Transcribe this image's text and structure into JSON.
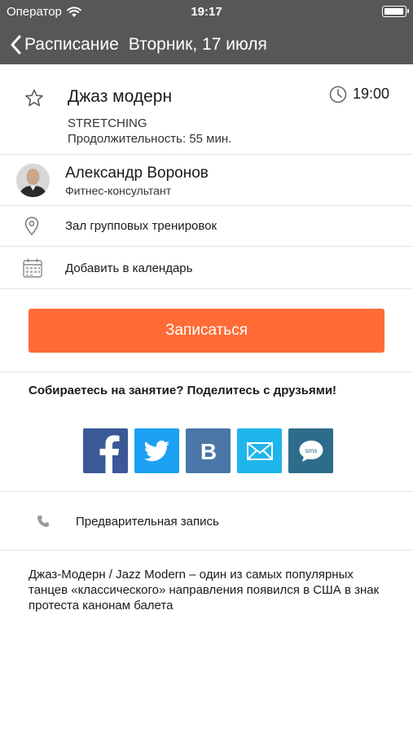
{
  "status_bar": {
    "carrier": "Оператор",
    "time": "19:17",
    "battery_level": 0.95
  },
  "nav": {
    "back_label": "Расписание",
    "title": "Вторник, 17 июля"
  },
  "class_info": {
    "title": "Джаз модерн",
    "type": "STRETCHING",
    "duration": "Продолжительность: 55 мин.",
    "time": "19:00",
    "favorite_icon": "star-outline-icon"
  },
  "trainer": {
    "name": "Александр Воронов",
    "role": "Фитнес-консультант"
  },
  "location": {
    "label": "Зал групповых тренировок",
    "icon": "location-pin-icon"
  },
  "calendar": {
    "label": "Добавить в календарь",
    "icon": "calendar-icon"
  },
  "signup": {
    "label": "Записаться",
    "color": "#ff6b35"
  },
  "share": {
    "title": "Собираетесь на занятие? Поделитесь с друзьями!",
    "buttons": [
      {
        "name": "facebook",
        "icon": "facebook-icon",
        "color": "#3b5998"
      },
      {
        "name": "twitter",
        "icon": "twitter-icon",
        "color": "#1da1f2"
      },
      {
        "name": "vkontakte",
        "icon": "vk-icon",
        "color": "#4a76a8"
      },
      {
        "name": "email",
        "icon": "mail-icon",
        "color": "#1eb6ea"
      },
      {
        "name": "sms",
        "icon": "sms-icon",
        "color": "#2e6c8c"
      }
    ]
  },
  "booking": {
    "label": "Предварительная запись",
    "icon": "phone-icon"
  },
  "description": {
    "text": "Джаз-Модерн / Jazz Modern –  один из самых популярных танцев «классического» направления появился в США в знак протеста канонам балета"
  },
  "colors": {
    "header_bg": "#57575a",
    "accent": "#ff6b35",
    "divider": "#e6e6e6"
  }
}
